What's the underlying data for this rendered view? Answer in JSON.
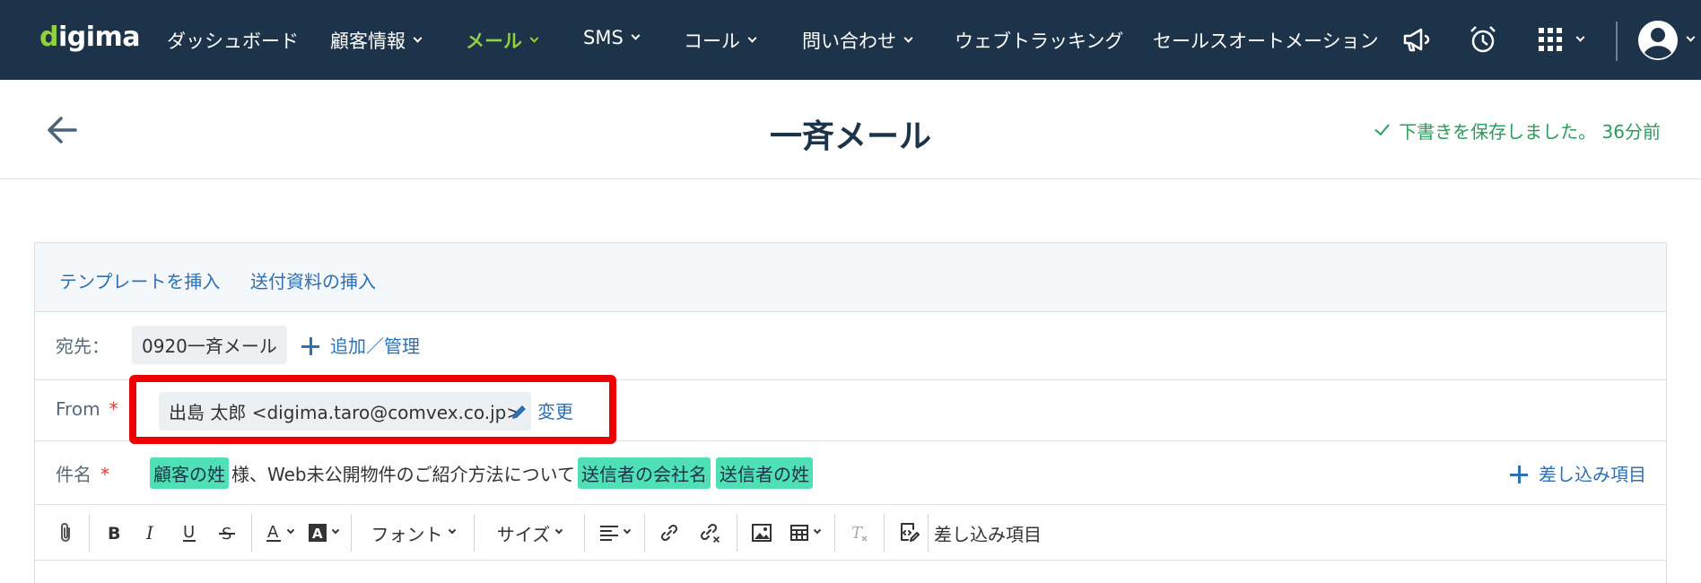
{
  "nav": {
    "logo_text": "digima",
    "items": [
      {
        "label": "ダッシュボード",
        "dropdown": false,
        "active": false
      },
      {
        "label": "顧客情報",
        "dropdown": true,
        "active": false
      },
      {
        "label": "メール",
        "dropdown": true,
        "active": true
      },
      {
        "label": "SMS",
        "dropdown": true,
        "active": false
      },
      {
        "label": "コール",
        "dropdown": true,
        "active": false
      },
      {
        "label": "問い合わせ",
        "dropdown": true,
        "active": false
      },
      {
        "label": "ウェブトラッキング",
        "dropdown": false,
        "active": false
      },
      {
        "label": "セールスオートメーション",
        "dropdown": false,
        "active": false
      }
    ],
    "icons": [
      "megaphone-icon",
      "alarm-clock-icon",
      "apps-grid-icon",
      "avatar-icon"
    ],
    "colors": {
      "bar": "#1c3349",
      "accent": "#8fd13f"
    }
  },
  "title": {
    "page_title": "一斉メール",
    "save_status": "下書きを保存しました。 36分前",
    "status_color": "#2a9d5c"
  },
  "editor": {
    "insert_template": "テンプレートを挿入",
    "insert_attachment": "送付資料の挿入",
    "to": {
      "label": "宛先：",
      "recipient": "0920一斉メール",
      "add_manage": "追加／管理"
    },
    "from": {
      "label": "From",
      "required_mark": "*",
      "sender": "出島 太郎 <digima.taro@comvex.co.jp>",
      "change": "変更"
    },
    "subject": {
      "label": "件名",
      "required_mark": "*",
      "tag1": "顧客の姓",
      "text1": "様、Web未公開物件のご紹介方法について",
      "tag2": "送信者の会社名",
      "tag3": "送信者の姓",
      "insert_field": "差し込み項目"
    },
    "toolbar": {
      "font": "フォント",
      "size": "サイズ",
      "merge_fields": "差し込み項目"
    }
  }
}
